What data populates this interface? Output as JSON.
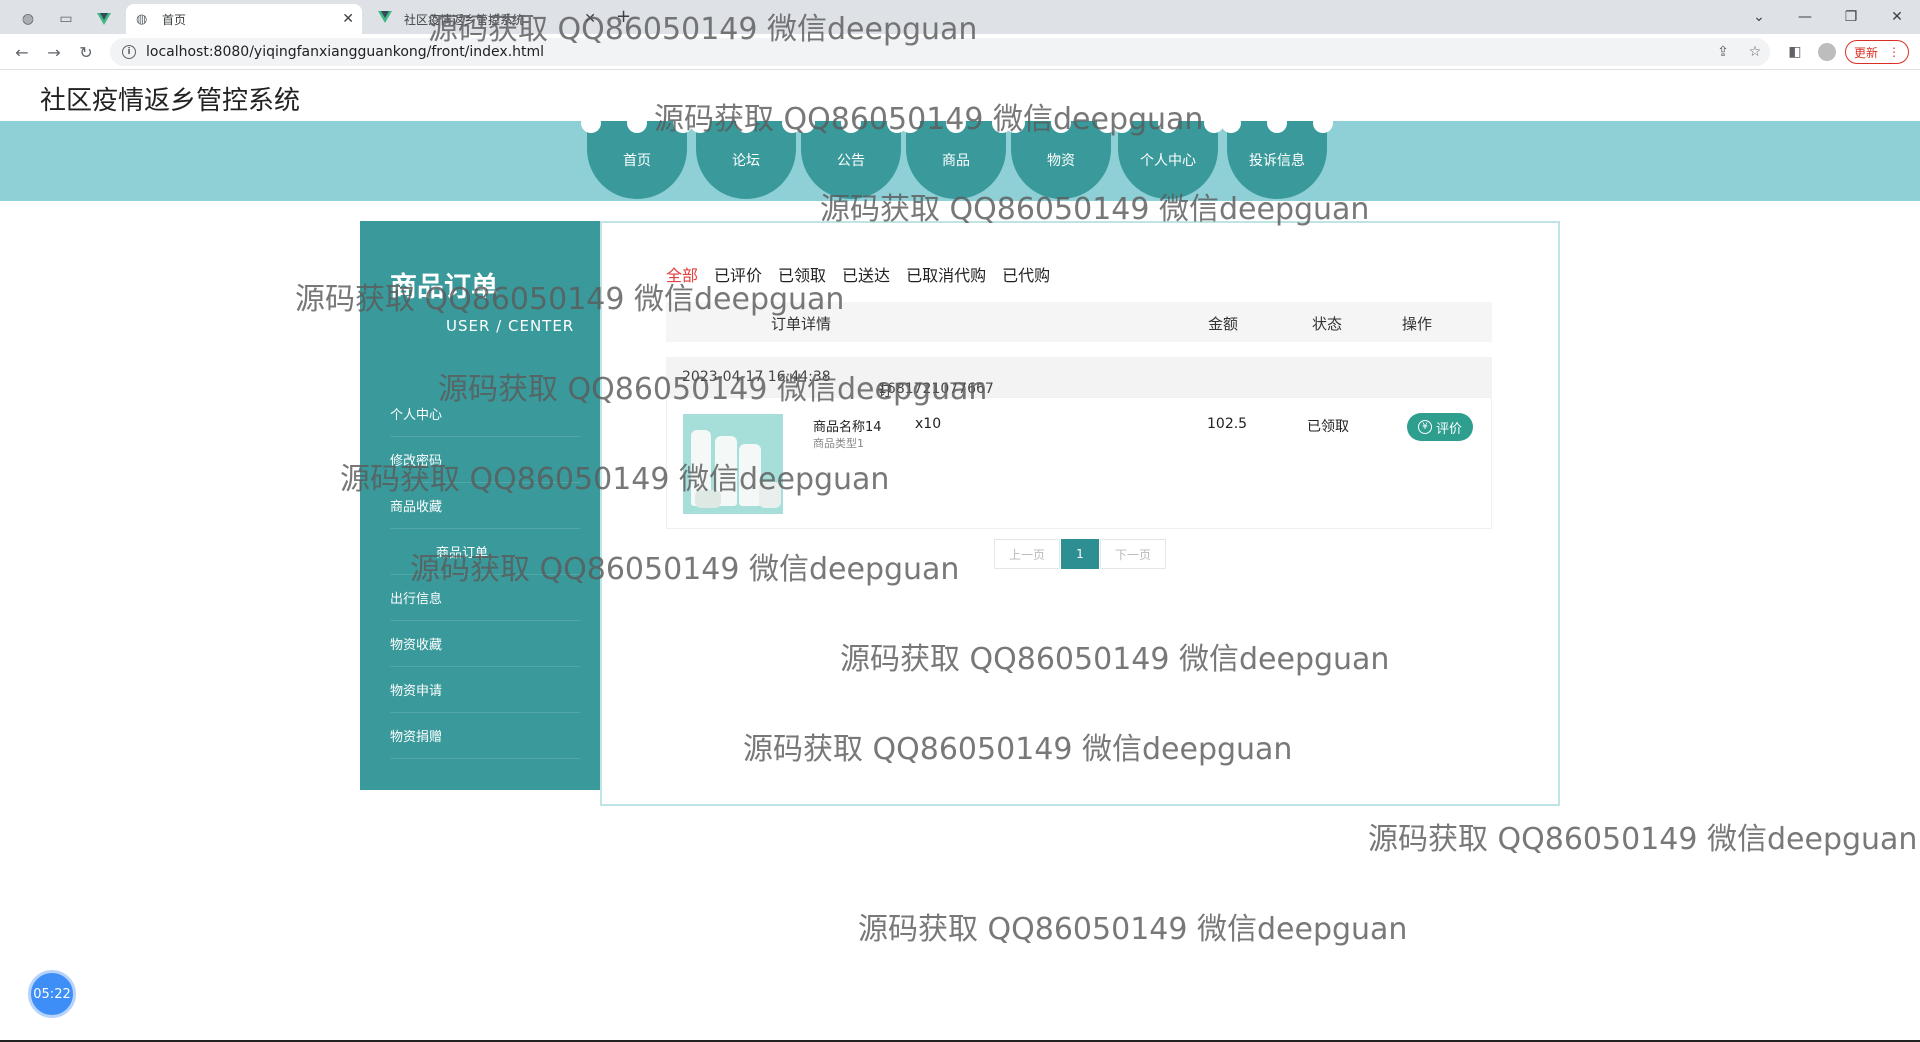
{
  "browser": {
    "tabs": [
      {
        "label": "首页",
        "active": true
      },
      {
        "label": "社区疫情返乡管控系统",
        "active": false
      }
    ],
    "url": "localhost:8080/yiqingfanxiangguankong/front/index.html",
    "update_label": "更新"
  },
  "site": {
    "title": "社区疫情返乡管控系统"
  },
  "nav": {
    "items": [
      "首页",
      "论坛",
      "公告",
      "商品",
      "物资",
      "个人中心",
      "投诉信息"
    ],
    "band_color": "#8fd0d6",
    "item_color": "#3a9a9b"
  },
  "sidebar": {
    "title": "商品订单",
    "subtitle": "USER / CENTER",
    "items": [
      "个人中心",
      "修改密码",
      "商品收藏",
      "商品订单",
      "出行信息",
      "物资收藏",
      "物资申请",
      "物资捐赠"
    ],
    "active_index": 3
  },
  "orders": {
    "status_tabs": [
      "全部",
      "已评价",
      "已领取",
      "已送达",
      "已取消代购",
      "已代购"
    ],
    "active_tab": 0,
    "columns": {
      "detail": "订单详情",
      "amount": "金额",
      "status": "状态",
      "action": "操作"
    },
    "list": [
      {
        "time": "2023-04-17 16:44:38",
        "order_no_label": "订单编号:",
        "order_no": "1681721077667",
        "product_name": "商品名称14",
        "product_type": "商品类型1",
        "quantity": "x10",
        "amount": "102.5",
        "status": "已领取",
        "action_label": "评价"
      }
    ]
  },
  "pagination": {
    "prev": "上一页",
    "current": "1",
    "next": "下一页"
  },
  "watermark": {
    "text": "源码获取 QQ86050149 微信deepguan"
  },
  "timer": {
    "value": "05:22"
  }
}
